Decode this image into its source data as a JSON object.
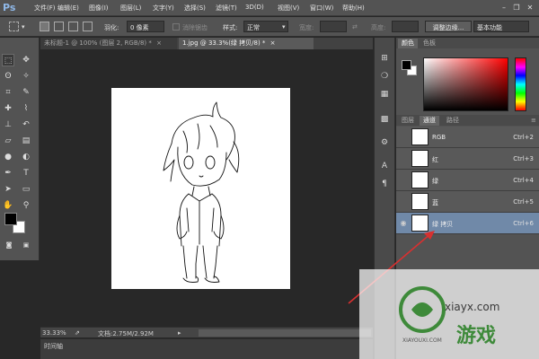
{
  "app": {
    "logo": "Ps"
  },
  "menu": [
    "文件(F)",
    "编辑(E)",
    "图像(I)",
    "图层(L)",
    "文字(Y)",
    "选择(S)",
    "滤镜(T)",
    "3D(D)",
    "视图(V)",
    "窗口(W)",
    "帮助(H)"
  ],
  "options": {
    "feather_label": "羽化:",
    "feather_value": "0 像素",
    "antialias_label": "消除锯齿",
    "style_label": "样式:",
    "style_value": "正常",
    "width_label": "宽度:",
    "height_label": "高度:",
    "refine_edge_button": "调整边缘...",
    "workspace_value": "基本功能"
  },
  "tabs": [
    {
      "label": "未标题-1 @ 100% (图层 2, RGB/8) *",
      "active": false
    },
    {
      "label": "1.jpg @ 33.3%(绿 拷贝/8) *",
      "active": true
    }
  ],
  "status": {
    "zoom": "33.33%",
    "doc_info": "文档:2.75M/2.92M",
    "timeline_label": "时间轴"
  },
  "panels": {
    "color_tabs": [
      "颜色",
      "色板"
    ],
    "layer_tabs": [
      "图层",
      "通道",
      "路径"
    ],
    "channels": [
      {
        "name": "RGB",
        "shortcut": "Ctrl+2",
        "visible": false,
        "selected": false
      },
      {
        "name": "红",
        "shortcut": "Ctrl+3",
        "visible": false,
        "selected": false
      },
      {
        "name": "绿",
        "shortcut": "Ctrl+4",
        "visible": false,
        "selected": false
      },
      {
        "name": "蓝",
        "shortcut": "Ctrl+5",
        "visible": false,
        "selected": false
      },
      {
        "name": "绿 拷贝",
        "shortcut": "Ctrl+6",
        "visible": true,
        "selected": true
      }
    ]
  },
  "watermark": {
    "brand": "游戏",
    "url": "xiayx.com",
    "sub": "XIAYOUXI.COM"
  },
  "colors": {
    "ui_bg": "#535353",
    "canvas_bg": "#282828",
    "selected_channel": "#7089a8",
    "arrow": "#d83030",
    "watermark_green": "#3e8a3a"
  }
}
